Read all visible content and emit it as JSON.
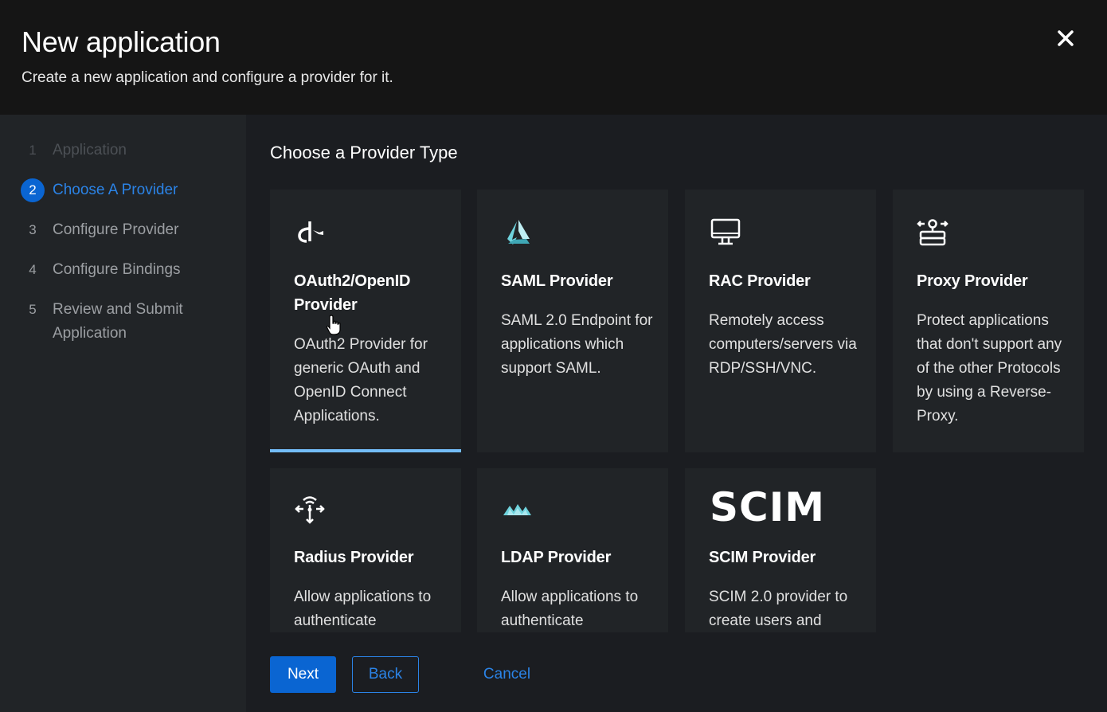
{
  "modal": {
    "title": "New application",
    "subtitle": "Create a new application and configure a provider for it.",
    "close_icon": "close-icon"
  },
  "steps": [
    {
      "number": "1",
      "label": "Application",
      "state": "disabled"
    },
    {
      "number": "2",
      "label": "Choose A Provider",
      "state": "current"
    },
    {
      "number": "3",
      "label": "Configure Provider",
      "state": "default"
    },
    {
      "number": "4",
      "label": "Configure Bindings",
      "state": "default"
    },
    {
      "number": "5",
      "label": "Review and Submit Application",
      "state": "default"
    }
  ],
  "main": {
    "section_title": "Choose a Provider Type"
  },
  "providers": [
    {
      "icon": "openid-icon",
      "title": "OAuth2/OpenID Provider",
      "description": "OAuth2 Provider for generic OAuth and OpenID Connect Applications.",
      "selected": true
    },
    {
      "icon": "saml-icon",
      "title": "SAML Provider",
      "description": "SAML 2.0 Endpoint for applications which support SAML."
    },
    {
      "icon": "desktop-icon",
      "title": "RAC Provider",
      "description": "Remotely access computers/servers via RDP/SSH/VNC."
    },
    {
      "icon": "proxy-icon",
      "title": "Proxy Provider",
      "description": "Protect applications that don't support any of the other Protocols by using a Reverse-Proxy."
    },
    {
      "icon": "radius-icon",
      "title": "Radius Provider",
      "description": "Allow applications to authenticate"
    },
    {
      "icon": "ldap-icon",
      "title": "LDAP Provider",
      "description": "Allow applications to authenticate"
    },
    {
      "icon": "scim-logo",
      "icon_text": "SCIM",
      "title": "SCIM Provider",
      "description": "SCIM 2.0 provider to create users and"
    }
  ],
  "footer": {
    "next_label": "Next",
    "back_label": "Back",
    "cancel_label": "Cancel"
  },
  "colors": {
    "accent": "#0a65d2",
    "link": "#2b83e6",
    "selected_border": "#73bcf7"
  }
}
